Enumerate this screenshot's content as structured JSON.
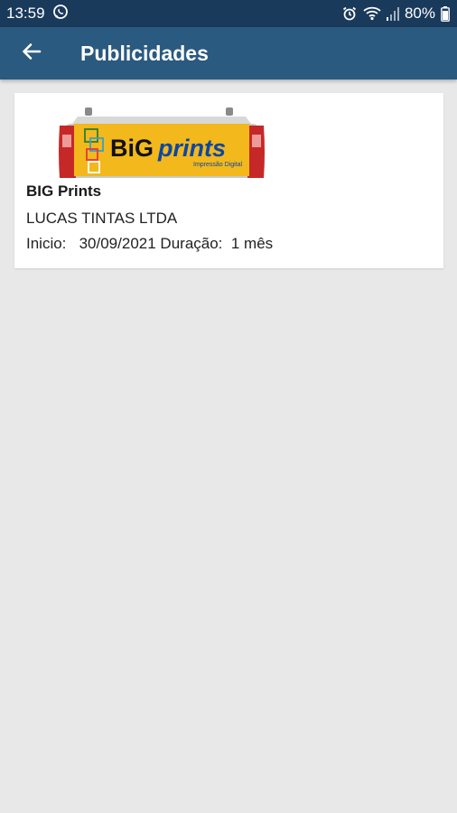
{
  "status_bar": {
    "time": "13:59",
    "battery": "80%"
  },
  "app_bar": {
    "title": "Publicidades",
    "back_icon": "arrow-left-icon"
  },
  "ad_card": {
    "title": "BIG Prints",
    "company": "LUCAS TINTAS LTDA",
    "start_label": "Inicio:",
    "start_date": "30/09/2021",
    "duration_label": "Duração:",
    "duration_value": "1 mês",
    "image": {
      "brand": "BiG prints",
      "brand_big": "BiG",
      "brand_prints": "prints",
      "tagline": "Impressão Digital",
      "background_color": "#f2b81c"
    }
  },
  "colors": {
    "status_bar": "#1a3a5c",
    "app_bar": "#2a5a80",
    "background": "#e8e8e8",
    "card": "#ffffff"
  }
}
